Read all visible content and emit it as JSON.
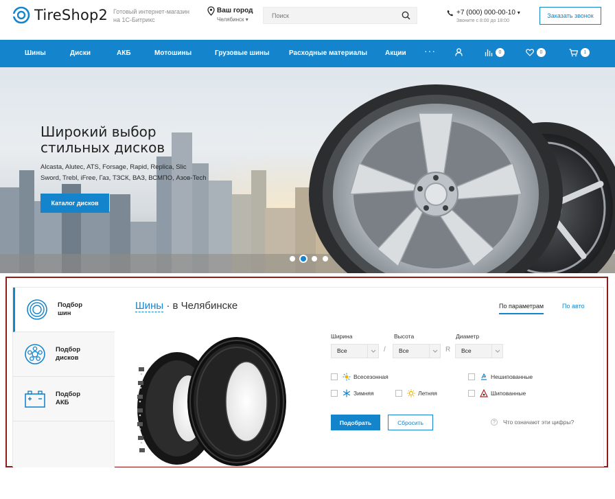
{
  "header": {
    "logo_text": "TireShop2",
    "tagline_line1": "Готовый интернет-магазин",
    "tagline_line2": "на 1С-Битрикс",
    "city_title": "Ваш город",
    "city_name": "Челябинск",
    "search_placeholder": "Поиск",
    "phone_number": "+7 (000) 000-00-10",
    "phone_hours": "Звоните с 8:00 до 18:00",
    "callback_label": "Заказать звонок"
  },
  "nav": {
    "items": [
      "Шины",
      "Диски",
      "АКБ",
      "Мотошины",
      "Грузовые шины",
      "Расходные материалы",
      "Акции"
    ],
    "more": "···",
    "compare_count": "0",
    "favorites_count": "0",
    "cart_count": "1"
  },
  "hero": {
    "title_line1": "Широкий выбор",
    "title_line2": "стильных дисков",
    "brands_line1": "Alcasta, Alutec, ATS, Forsage, Rapid, Replica, Slic",
    "brands_line2": "Sword, Trebl, iFree, Газ, ТЗСК, ВАЗ, ВСМПО, Азов-Tech",
    "button_label": "Каталог дисков",
    "slide_count": 4,
    "active_slide": 2
  },
  "picker": {
    "tabs": [
      {
        "line1": "Подбор",
        "line2": "шин"
      },
      {
        "line1": "Подбор",
        "line2": "дисков"
      },
      {
        "line1": "Подбор",
        "line2": "АКБ"
      }
    ],
    "title_link": "Шины",
    "title_rest": " · в Челябинске",
    "mode_params": "По параметрам",
    "mode_auto": "По авто",
    "fields": {
      "width_label": "Ширина",
      "height_label": "Высота",
      "diameter_label": "Диаметр",
      "width_value": "Все",
      "height_value": "Все",
      "diameter_value": "Все",
      "sep1": "/",
      "sep2": "R"
    },
    "seasons": {
      "allseason": "Всесезонная",
      "winter": "Зимняя",
      "summer": "Летняя",
      "nonstudded": "Нешипованные",
      "studded": "Шипованные"
    },
    "submit_label": "Подобрать",
    "reset_label": "Сбросить",
    "help_text": "Что означают эти цифры?",
    "help_mark": "?"
  },
  "colors": {
    "accent": "#1485cd",
    "outline": "#8f1b1b"
  }
}
